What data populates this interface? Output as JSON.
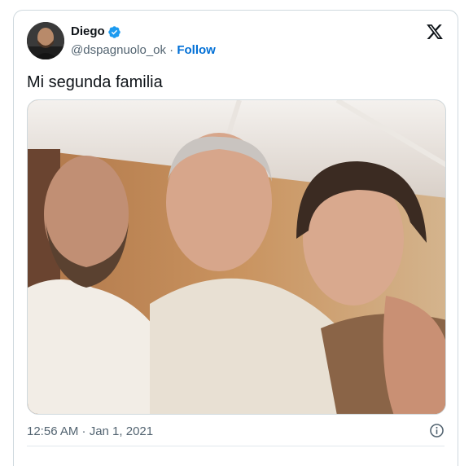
{
  "author": {
    "name": "Diego",
    "handle": "@dspagnuolo_ok",
    "separator": "·",
    "follow_label": "Follow"
  },
  "tweet": {
    "text": "Mi segunda familia",
    "timestamp": "12:56 AM · Jan 1, 2021"
  },
  "icons": {
    "verified": "verified-badge-icon",
    "brand": "x-logo-icon",
    "info": "info-icon"
  },
  "colors": {
    "accent": "#1d9bf0",
    "follow": "#006fd6",
    "text": "#0f1419",
    "secondary": "#536471"
  }
}
